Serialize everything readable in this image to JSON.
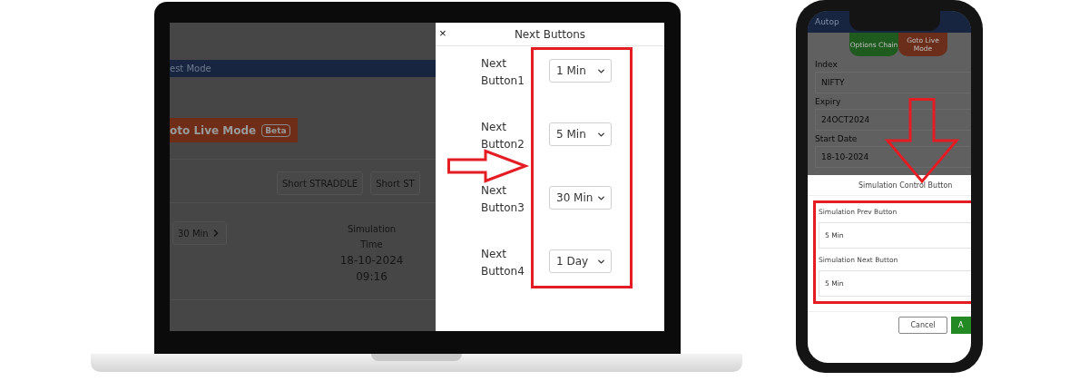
{
  "laptop": {
    "background": {
      "mode_bar": "est Mode",
      "live_button": {
        "label": "oto Live Mode",
        "badge": "Beta"
      },
      "strategy_buttons": [
        "Short STRADDLE",
        "Short ST"
      ],
      "step_button": "30 Min",
      "simulation": {
        "label_lines": [
          "Simulation",
          "Time"
        ],
        "date": "18-10-2024",
        "time": "09:16"
      }
    },
    "modal": {
      "close": "×",
      "title": "Next Buttons",
      "rows": [
        {
          "label": "Next Button1",
          "value": "1 Min"
        },
        {
          "label": "Next Button2",
          "value": "5 Min"
        },
        {
          "label": "Next Button3",
          "value": "30 Min"
        },
        {
          "label": "Next Button4",
          "value": "1 Day"
        }
      ]
    }
  },
  "phone": {
    "header": "Autop",
    "pills": [
      {
        "label": "Options Chain",
        "color": "#1f5a1f"
      },
      {
        "label": "Goto Live Mode",
        "color": "#6b2e1a"
      }
    ],
    "fields": [
      {
        "label": "Index",
        "value": "NIFTY"
      },
      {
        "label": "Expiry",
        "value": "24OCT2024"
      },
      {
        "label": "Start Date",
        "value": "18-10-2024"
      }
    ],
    "sheet": {
      "title": "Simulation Control Button",
      "fields": [
        {
          "label": "Simulation Prev Button",
          "value": "5 Min"
        },
        {
          "label": "Simulation Next Button",
          "value": "5 Min"
        }
      ],
      "buttons": [
        "Cancel",
        "A"
      ]
    }
  }
}
